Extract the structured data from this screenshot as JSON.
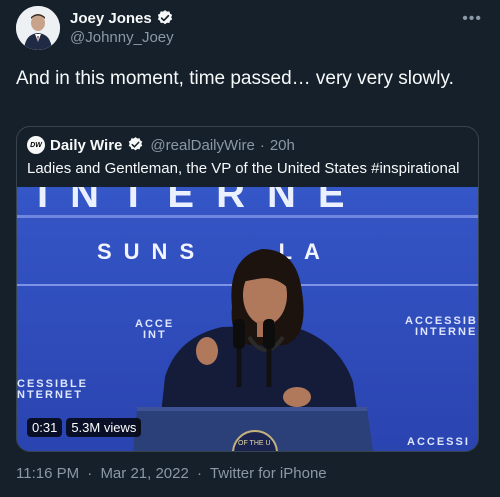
{
  "author": {
    "display_name": "Joey Jones",
    "handle": "@Johnny_Joey",
    "verified_color": "#1d9bf0"
  },
  "tweet": {
    "text": "And in this moment, time passed… very very slowly.",
    "more_icon": "more-icon"
  },
  "quote": {
    "avatar_text": "DW",
    "name": "Daily Wire",
    "handle": "@realDailyWire",
    "separator": "·",
    "age": "20h",
    "text": "Ladies and Gentleman, the VP of the United States #inspirational"
  },
  "video": {
    "duration": "0:31",
    "views": "5.3M views",
    "backdrop_top": "INTERNE",
    "backdrop_city": "SUNS    LA",
    "backdrop_left": "ACCE",
    "backdrop_left2": "INT",
    "backdrop_right": "ACCESSIB",
    "backdrop_right2": "INTERNE",
    "backdrop_bl": "CESSIBLE",
    "backdrop_bl2": "NTERNET",
    "backdrop_br": "ACCESSI",
    "seal_text": "OF THE U"
  },
  "meta": {
    "time": "11:16 PM",
    "separator": "·",
    "date": "Mar 21, 2022",
    "source": "Twitter for iPhone"
  }
}
